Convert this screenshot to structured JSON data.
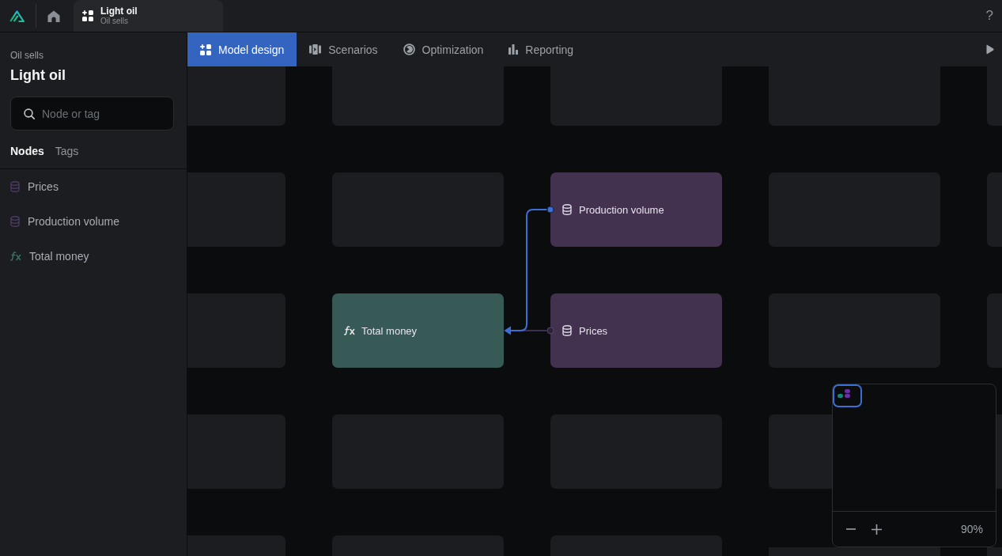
{
  "topbar": {
    "tab": {
      "title": "Light oil",
      "subtitle": "Oil sells",
      "selected": true
    },
    "help": "?"
  },
  "sidebar": {
    "subtitle": "Oil sells",
    "title": "Light oil",
    "search": {
      "placeholder": "Node or tag"
    },
    "tabs": [
      {
        "label": "Nodes",
        "selected": true
      },
      {
        "label": "Tags",
        "selected": false
      }
    ],
    "items": [
      {
        "label": "Prices",
        "kind": "data"
      },
      {
        "label": "Production volume",
        "kind": "data"
      },
      {
        "label": "Total money",
        "kind": "formula"
      }
    ]
  },
  "tabs": [
    {
      "label": "Model design",
      "selected": true
    },
    {
      "label": "Scenarios",
      "selected": false
    },
    {
      "label": "Optimization",
      "selected": false
    },
    {
      "label": "Reporting",
      "selected": false
    }
  ],
  "canvas": {
    "rows": [
      {
        "slots": [
          {
            "kind": "empty"
          },
          {
            "kind": "empty"
          },
          {
            "kind": "empty"
          },
          {
            "kind": "empty"
          },
          {
            "kind": "empty"
          }
        ]
      },
      {
        "slots": [
          {
            "kind": "empty"
          },
          {
            "kind": "empty"
          },
          {
            "kind": "data",
            "label": "Production volume",
            "link": {
              "highlighted": true
            }
          },
          {
            "kind": "empty"
          },
          {
            "kind": "empty"
          }
        ]
      },
      {
        "slots": [
          {
            "kind": "empty"
          },
          {
            "kind": "formula",
            "label": "Total money"
          },
          {
            "kind": "data",
            "label": "Prices",
            "link": {
              "highlighted": false
            }
          },
          {
            "kind": "empty"
          },
          {
            "kind": "empty"
          }
        ]
      },
      {
        "slots": [
          {
            "kind": "empty"
          },
          {
            "kind": "empty"
          },
          {
            "kind": "empty"
          },
          {
            "kind": "empty"
          },
          {
            "kind": "empty"
          }
        ]
      },
      {
        "slots": [
          {
            "kind": "empty"
          },
          {
            "kind": "empty"
          },
          {
            "kind": "empty"
          },
          {
            "kind": "empty"
          },
          {
            "kind": "empty"
          }
        ]
      }
    ]
  },
  "minimap": {
    "zoom": "90%"
  }
}
